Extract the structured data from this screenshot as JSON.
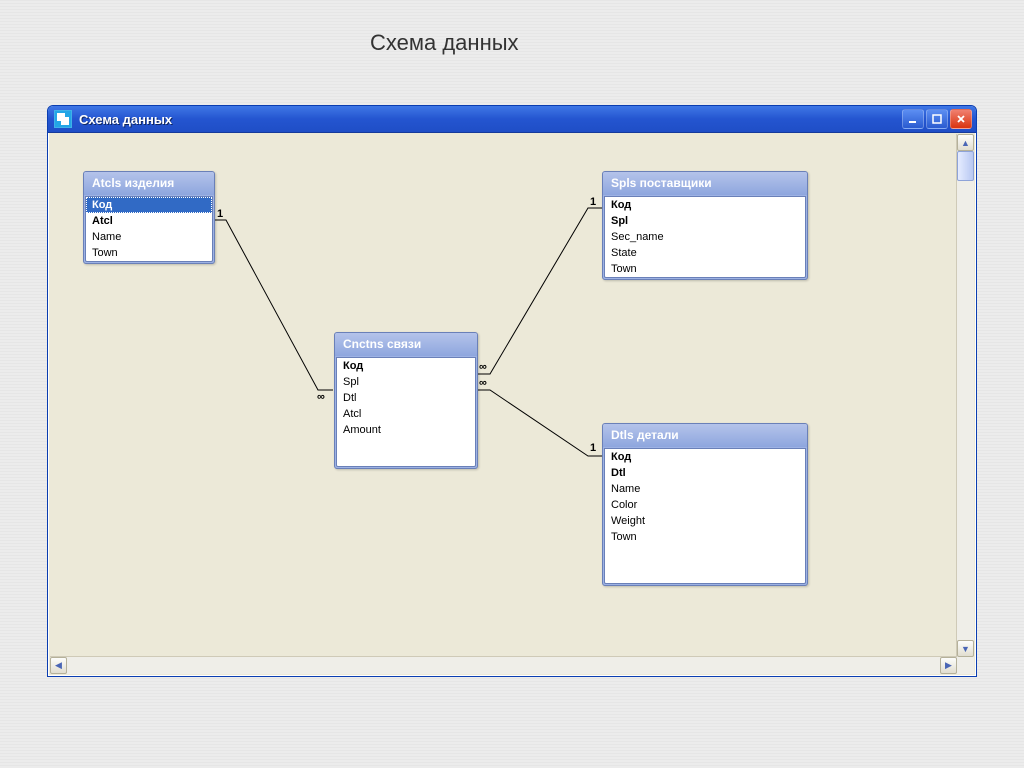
{
  "page_title": "Схема данных",
  "window_title": "Схема данных",
  "tables": {
    "atcls": {
      "title": "Atcls изделия",
      "fields": [
        "Код",
        "Atcl",
        "Name",
        "Town"
      ],
      "pk_rows": [
        0,
        1
      ],
      "selected_row": 0
    },
    "spls": {
      "title": "Spls поставщики",
      "fields": [
        "Код",
        "Spl",
        "Sec_name",
        "State",
        "Town"
      ],
      "pk_rows": [
        0,
        1
      ]
    },
    "cnctns": {
      "title": "Cnctns связи",
      "fields": [
        "Код",
        "Spl",
        "Dtl",
        "Atcl",
        "Amount"
      ],
      "pk_rows": [
        0
      ]
    },
    "dtls": {
      "title": "Dtls детали",
      "fields": [
        "Код",
        "Dtl",
        "Name",
        "Color",
        "Weight",
        "Town"
      ],
      "pk_rows": [
        0,
        1
      ]
    }
  },
  "relationships": [
    {
      "id": "atcls-cnctns",
      "one_label": "1",
      "many_label": "∞"
    },
    {
      "id": "spls-cnctns",
      "one_label": "1",
      "many_label": "∞"
    },
    {
      "id": "dtls-cnctns",
      "one_label": "1",
      "many_label": "∞"
    }
  ]
}
